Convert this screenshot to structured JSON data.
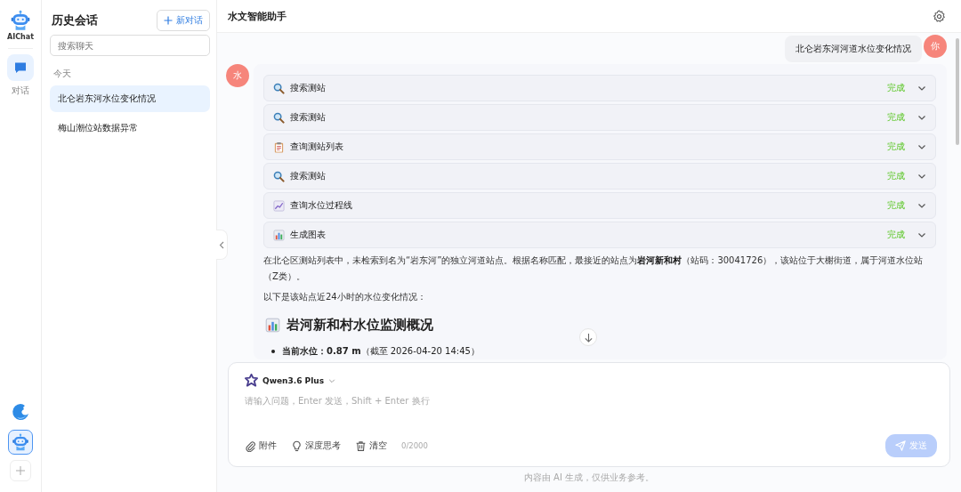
{
  "rail": {
    "brand": "AIChat",
    "nav": [
      {
        "label": "对话",
        "selected": true
      }
    ],
    "apps": [
      {
        "kind": "wave",
        "selected": false
      },
      {
        "kind": "robot",
        "selected": true
      }
    ]
  },
  "history": {
    "title": "历史会话",
    "new_button": "新对话",
    "search": {
      "placeholder": "搜索聊天"
    },
    "group": "今天",
    "items": [
      {
        "title": "北仑岩东河水位变化情况",
        "selected": true
      },
      {
        "title": "梅山潮位站数据异常",
        "selected": false
      }
    ]
  },
  "header": {
    "title": "水文智能助手"
  },
  "messages": {
    "user": {
      "avatar": "你",
      "text": "北仑岩东河河道水位变化情况"
    },
    "assistant": {
      "avatar": "水",
      "steps": [
        {
          "kind": "search",
          "label": "搜索测站",
          "status": "完成",
          "expanded": false
        },
        {
          "kind": "search",
          "label": "搜索测站",
          "status": "完成",
          "expanded": false
        },
        {
          "kind": "list",
          "label": "查询测站列表",
          "status": "完成",
          "expanded": false
        },
        {
          "kind": "search",
          "label": "搜索测站",
          "status": "完成",
          "expanded": false
        },
        {
          "kind": "line",
          "label": "查询水位过程线",
          "status": "完成",
          "expanded": false
        },
        {
          "kind": "bar",
          "label": "生成图表",
          "status": "完成",
          "expanded": false
        }
      ],
      "paragraphs": [
        "在北仑区测站列表中，未检索到名为“岩东河”的独立河道站点。根据名称匹配，最接近的站点为**岩河新和村**（站码：30041726），该站位于大榭街道，属于河道水位站（Z类）。",
        "以下是该站点近24小时的水位变化情况："
      ],
      "heading": "岩河新和村水位监测概况",
      "bullets": [
        "**当前水位：0.87 m**（截至 2026-04-20 14:45）"
      ]
    }
  },
  "composer": {
    "model": "Qwen3.6 Plus",
    "placeholder": "请输入问题，Enter 发送，Shift + Enter 换行",
    "tools": [
      {
        "kind": "attach",
        "label": "附件"
      },
      {
        "kind": "think",
        "label": "深度思考"
      },
      {
        "kind": "clear",
        "label": "清空"
      }
    ],
    "count": "0/2000",
    "send": "发送",
    "send_disabled": true
  },
  "footer": "内容由 AI 生成，仅供业务参考。"
}
